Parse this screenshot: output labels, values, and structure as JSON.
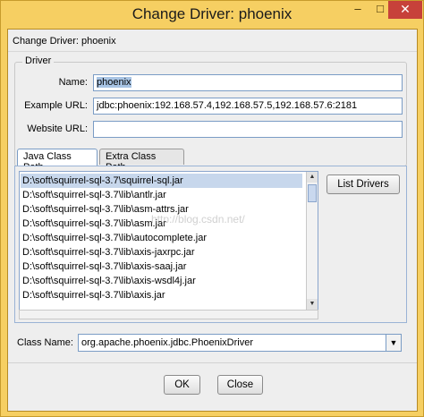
{
  "window": {
    "title": "Change Driver: phoenix",
    "min_glyph": "–",
    "max_glyph": "□",
    "close_glyph": "✕"
  },
  "dialog": {
    "header": "Change Driver: phoenix",
    "group_title": "Driver",
    "name_label": "Name:",
    "name_value": "phoenix",
    "example_url_label": "Example URL:",
    "example_url_value": "jdbc:phoenix:192.168.57.4,192.168.57.5,192.168.57.6:2181",
    "website_url_label": "Website URL:",
    "website_url_value": ""
  },
  "tabs": [
    {
      "label": "Java Class Path",
      "active": true
    },
    {
      "label": "Extra Class Path",
      "active": false
    }
  ],
  "class_path": {
    "items": [
      "D:\\soft\\squirrel-sql-3.7\\squirrel-sql.jar",
      "D:\\soft\\squirrel-sql-3.7\\lib\\antlr.jar",
      "D:\\soft\\squirrel-sql-3.7\\lib\\asm-attrs.jar",
      "D:\\soft\\squirrel-sql-3.7\\lib\\asm.jar",
      "D:\\soft\\squirrel-sql-3.7\\lib\\autocomplete.jar",
      "D:\\soft\\squirrel-sql-3.7\\lib\\axis-jaxrpc.jar",
      "D:\\soft\\squirrel-sql-3.7\\lib\\axis-saaj.jar",
      "D:\\soft\\squirrel-sql-3.7\\lib\\axis-wsdl4j.jar",
      "D:\\soft\\squirrel-sql-3.7\\lib\\axis.jar"
    ],
    "list_drivers_label": "List Drivers"
  },
  "class_name": {
    "label": "Class Name:",
    "value": "org.apache.phoenix.jdbc.PhoenixDriver"
  },
  "footer": {
    "ok_label": "OK",
    "close_label": "Close"
  },
  "watermark": "http://blog.csdn.net/"
}
